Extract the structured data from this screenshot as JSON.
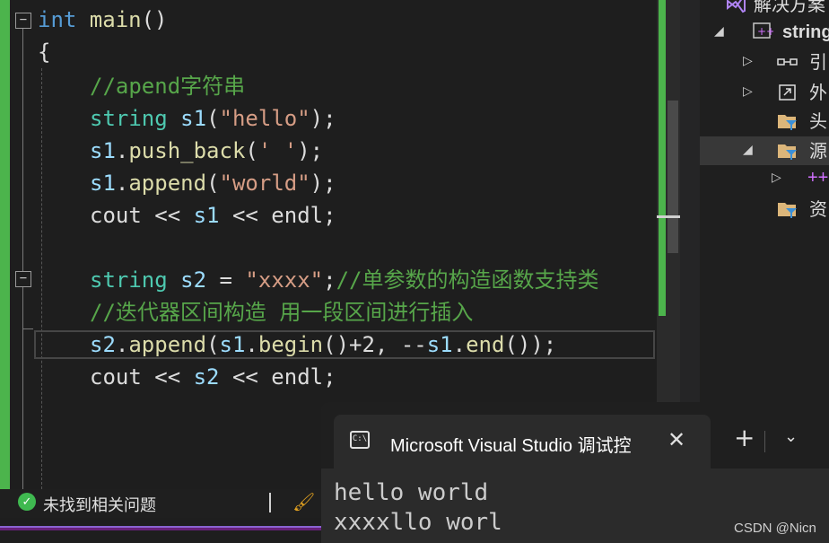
{
  "editor": {
    "lines": {
      "l0": {
        "kw": "int",
        "name": " main",
        "paren": "()"
      },
      "l1": {
        "brace": "{"
      },
      "l2": {
        "comment": "//apend字符串"
      },
      "l3": {
        "type": "string",
        "v": " s1",
        "p1": "(",
        "s": "\"hello\"",
        "p2": ");"
      },
      "l4": {
        "v": "s1",
        "dot": ".",
        "fn": "push_back",
        "p1": "(",
        "s": "' '",
        "p2": ");"
      },
      "l5": {
        "v": "s1",
        "dot": ".",
        "fn": "append",
        "p1": "(",
        "s": "\"world\"",
        "p2": ");"
      },
      "l6": {
        "a": "cout",
        "op1": " << ",
        "v": "s1",
        "op2": " << ",
        "b": "endl",
        "end": ";"
      },
      "l8": {
        "type": "string",
        "v": " s2",
        "eq": " = ",
        "s": "\"xxxx\"",
        "semi": ";",
        "comment": "//单参数的构造函数支持类"
      },
      "l9": {
        "comment": "//迭代器区间构造 用一段区间进行插入"
      },
      "l10": {
        "v": "s2",
        "dot": ".",
        "fn": "append",
        "p1": "(",
        "v2": "s1",
        "dot2": ".",
        "fn2": "begin",
        "p2": "()+2, --",
        "v3": "s1",
        "dot3": ".",
        "fn3": "end",
        "p3": "());"
      },
      "l11": {
        "a": "cout",
        "op1": " << ",
        "v": "s2",
        "op2": " << ",
        "b": "endl",
        "end": ";"
      }
    }
  },
  "solution_explorer": {
    "items": [
      {
        "label": "解决方案"
      },
      {
        "label": "string"
      },
      {
        "label": "引"
      },
      {
        "label": "外"
      },
      {
        "label": "头"
      },
      {
        "label": "源"
      },
      {
        "label": "++"
      },
      {
        "label": "资"
      }
    ]
  },
  "status": {
    "issues_text": "未找到相关问题"
  },
  "terminal": {
    "tab_title": "Microsoft Visual Studio 调试控",
    "tab_icon_text": "C:\\",
    "new_tab": "+",
    "output": [
      "hello world",
      "xxxxllo worl"
    ]
  },
  "watermark": "CSDN @Nicn",
  "colors": {
    "keyword": "#569cd6",
    "type": "#4ec9b0",
    "string": "#d69d85",
    "comment": "#57a64a",
    "variable": "#9cdcfe",
    "function": "#dcdcaa",
    "git_green": "#4cb44c"
  }
}
